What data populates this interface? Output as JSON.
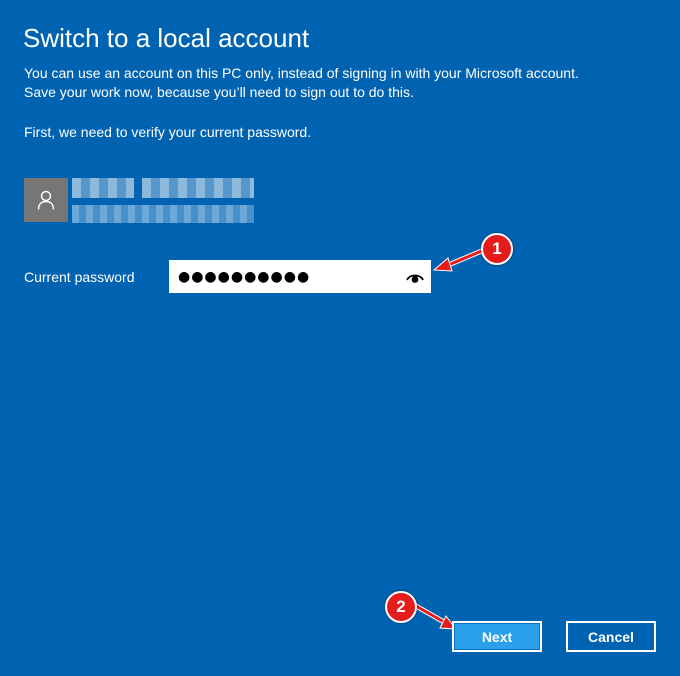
{
  "dialog": {
    "title": "Switch to a local account",
    "description_line1": "You can use an account on this PC only, instead of signing in with your Microsoft account.",
    "description_line2": "Save your work now, because you’ll need to sign out to do this.",
    "verify_text": "First, we need to verify your current password."
  },
  "account": {
    "avatar_icon": "user-icon"
  },
  "password": {
    "label": "Current password",
    "value": "●●●●●●●●●●",
    "reveal_icon": "eye-icon"
  },
  "buttons": {
    "next_label": "Next",
    "cancel_label": "Cancel"
  },
  "annotations": {
    "step1": "1",
    "step2": "2",
    "color": "#e51c1c"
  },
  "colors": {
    "background": "#0063b1",
    "next_button": "#2aa0ea",
    "avatar_bg": "#767676"
  }
}
